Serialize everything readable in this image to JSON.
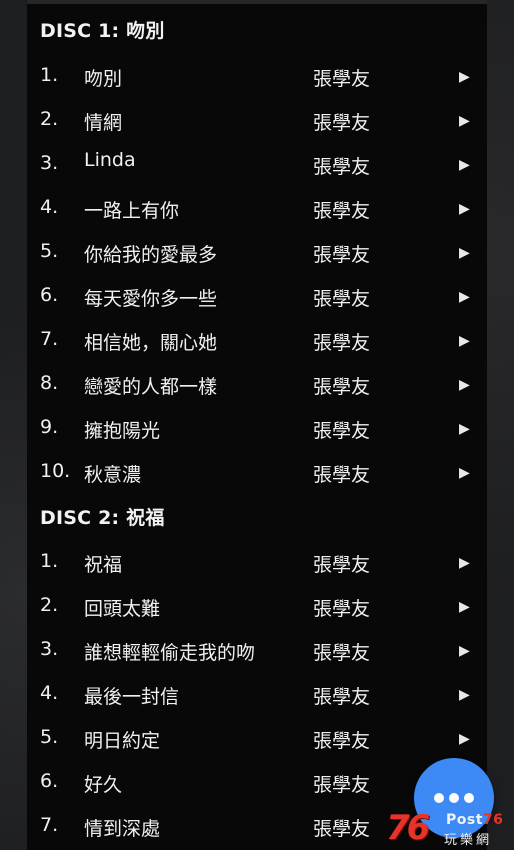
{
  "discs": [
    {
      "header": "DISC 1: 吻別",
      "tracks": [
        {
          "num": "1.",
          "title": "吻別",
          "artist": "張學友",
          "play": "▶"
        },
        {
          "num": "2.",
          "title": "情網",
          "artist": "張學友",
          "play": "▶"
        },
        {
          "num": "3.",
          "title": "Linda",
          "artist": "張學友",
          "play": "▶"
        },
        {
          "num": "4.",
          "title": "一路上有你",
          "artist": "張學友",
          "play": "▶"
        },
        {
          "num": "5.",
          "title": "你給我的愛最多",
          "artist": "張學友",
          "play": "▶"
        },
        {
          "num": "6.",
          "title": "每天愛你多一些",
          "artist": "張學友",
          "play": "▶"
        },
        {
          "num": "7.",
          "title": "相信她，關心她",
          "artist": "張學友",
          "play": "▶"
        },
        {
          "num": "8.",
          "title": "戀愛的人都一樣",
          "artist": "張學友",
          "play": "▶"
        },
        {
          "num": "9.",
          "title": "擁抱陽光",
          "artist": "張學友",
          "play": "▶"
        },
        {
          "num": "10.",
          "title": "秋意濃",
          "artist": "張學友",
          "play": "▶"
        }
      ]
    },
    {
      "header": "DISC 2: 祝福",
      "tracks": [
        {
          "num": "1.",
          "title": "祝福",
          "artist": "張學友",
          "play": "▶"
        },
        {
          "num": "2.",
          "title": "回頭太難",
          "artist": "張學友",
          "play": "▶"
        },
        {
          "num": "3.",
          "title": "誰想輕輕偷走我的吻",
          "artist": "張學友",
          "play": "▶"
        },
        {
          "num": "4.",
          "title": "最後一封信",
          "artist": "張學友",
          "play": "▶"
        },
        {
          "num": "5.",
          "title": "明日約定",
          "artist": "張學友",
          "play": "▶"
        },
        {
          "num": "6.",
          "title": "好久",
          "artist": "張學友",
          "play": "▶"
        },
        {
          "num": "7.",
          "title": "情到深處",
          "artist": "張學友",
          "play": "▶"
        }
      ]
    }
  ],
  "fab": {
    "icon": "more-horizontal-icon",
    "color": "#3d8af7"
  },
  "watermark": {
    "digits": "76",
    "brand_prefix": "Post",
    "brand_number": "76",
    "subtitle": "玩樂網",
    "accent": "#e8332a"
  }
}
